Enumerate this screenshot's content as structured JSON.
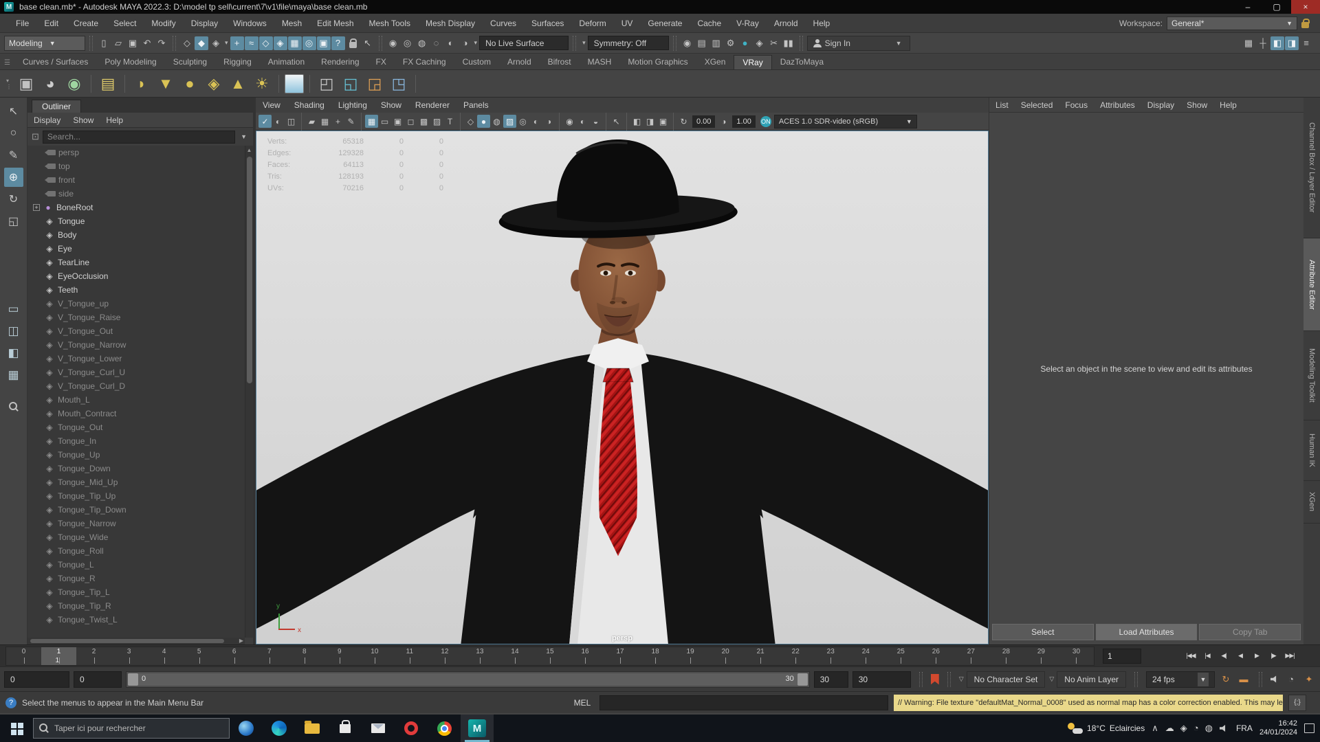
{
  "window": {
    "title": "base clean.mb* - Autodesk MAYA 2022.3: D:\\model tp sell\\current\\7\\v1\\file\\maya\\base clean.mb",
    "controls": [
      {
        "name": "minimize-button",
        "glyph": "–"
      },
      {
        "name": "maximize-button",
        "glyph": "▢"
      },
      {
        "name": "close-button",
        "glyph": "×"
      }
    ]
  },
  "menubar": {
    "items": [
      "File",
      "Edit",
      "Create",
      "Select",
      "Modify",
      "Display",
      "Windows",
      "Mesh",
      "Edit Mesh",
      "Mesh Tools",
      "Mesh Display",
      "Curves",
      "Surfaces",
      "Deform",
      "UV",
      "Generate",
      "Cache",
      "V-Ray",
      "Arnold",
      "Help"
    ],
    "workspace_label": "Workspace:",
    "workspace_value": "General*"
  },
  "statusline": {
    "mode": "Modeling",
    "no_live_surface": "No Live Surface",
    "symmetry": "Symmetry: Off",
    "signin": "Sign In",
    "file_icons": [
      {
        "name": "new-scene-icon",
        "glyph": "▯"
      },
      {
        "name": "open-scene-icon",
        "glyph": "▱"
      },
      {
        "name": "save-scene-icon",
        "glyph": "▣"
      },
      {
        "name": "undo-icon",
        "glyph": "↶"
      },
      {
        "name": "redo-icon",
        "glyph": "↷"
      }
    ],
    "selection_icons": [
      {
        "name": "select-hierarchy-icon",
        "glyph": "◇"
      },
      {
        "name": "select-object-icon",
        "glyph": "◆",
        "hl": true
      },
      {
        "name": "select-component-icon",
        "glyph": "◈"
      }
    ],
    "snap_icons": [
      {
        "name": "snap-grid-icon",
        "glyph": "+",
        "hl": true
      },
      {
        "name": "snap-curve-icon",
        "glyph": "≈",
        "hl": true
      },
      {
        "name": "snap-point-icon",
        "glyph": "◇",
        "hl": true
      },
      {
        "name": "snap-projected-center-icon",
        "glyph": "◈",
        "hl": true
      },
      {
        "name": "snap-view-plane-icon",
        "glyph": "▦",
        "hl": true
      },
      {
        "name": "make-live-icon",
        "glyph": "◎",
        "hl": true
      },
      {
        "name": "quick-rename-icon",
        "glyph": "▣",
        "hl": true
      },
      {
        "name": "snap-help-icon",
        "glyph": "?",
        "hl": true
      }
    ],
    "history_icons": [
      {
        "name": "input-connections-icon",
        "glyph": "◉"
      },
      {
        "name": "output-connections-icon",
        "glyph": "◎"
      },
      {
        "name": "construction-history-icon",
        "glyph": "◍"
      },
      {
        "name": "node-editor-icon",
        "glyph": "◌"
      },
      {
        "name": "hypergraph-icon",
        "glyph": "◐"
      },
      {
        "name": "connection-editor-icon",
        "glyph": "◑"
      }
    ],
    "render_icons": [
      {
        "name": "render-current-frame-icon",
        "glyph": "◉"
      },
      {
        "name": "render-region-icon",
        "glyph": "▤"
      },
      {
        "name": "ipr-render-icon",
        "glyph": "▥"
      },
      {
        "name": "render-settings-icon",
        "glyph": "⚙"
      },
      {
        "name": "color-management-icon",
        "glyph": "●",
        "color": "#3fb2c4"
      },
      {
        "name": "light-editor-icon",
        "glyph": "◈"
      },
      {
        "name": "render-setup-icon",
        "glyph": "✂"
      },
      {
        "name": "pause-viewport-icon",
        "glyph": "▮▮"
      }
    ],
    "right_icons": [
      {
        "name": "modeling-toolkit-toggle-icon",
        "glyph": "▦"
      },
      {
        "name": "humanik-toggle-icon",
        "glyph": "┼"
      },
      {
        "name": "channel-box-toggle-icon",
        "glyph": "◧",
        "hl": true
      },
      {
        "name": "attribute-editor-toggle-icon",
        "glyph": "◨",
        "hl": true
      },
      {
        "name": "display-layers-toggle-icon",
        "glyph": "≡"
      }
    ]
  },
  "shelf": {
    "tabs": [
      "Curves / Surfaces",
      "Poly Modeling",
      "Sculpting",
      "Rigging",
      "Animation",
      "Rendering",
      "FX",
      "FX Caching",
      "Custom",
      "Arnold",
      "Bifrost",
      "MASH",
      "Motion Graphics",
      "XGen",
      "VRay",
      "DazToMaya"
    ],
    "active_tab": "VRay",
    "icons": [
      {
        "name": "vray-render-settings-icon",
        "glyph": "▣",
        "color": "#c2c2c2"
      },
      {
        "name": "vray-frame-buffer-icon",
        "glyph": "◕",
        "color": "#cccccc"
      },
      {
        "name": "vray-render-icon",
        "glyph": "◉",
        "color": "#9fd6a0"
      },
      {
        "divider": true
      },
      {
        "name": "vray-light-lister-icon",
        "glyph": "▤",
        "color": "#ddc96a"
      },
      {
        "divider": true
      },
      {
        "name": "vray-dome-light-icon",
        "glyph": "◗",
        "color": "#d9c255"
      },
      {
        "name": "vray-rect-light-icon",
        "glyph": "▼",
        "color": "#d9c255"
      },
      {
        "name": "vray-sphere-light-icon",
        "glyph": "●",
        "color": "#d9c255"
      },
      {
        "name": "vray-geo-sphere-icon",
        "glyph": "◈",
        "color": "#d9c255"
      },
      {
        "name": "vray-ies-light-icon",
        "glyph": "▲",
        "color": "#d9c255"
      },
      {
        "name": "vray-sun-light-icon",
        "glyph": "☀",
        "color": "#d9c255"
      },
      {
        "divider": true
      },
      {
        "name": "vray-sky-icon",
        "cls": "sky"
      },
      {
        "divider": true
      },
      {
        "name": "vray-proxy-export-icon",
        "glyph": "◰",
        "color": "#c8c8c8"
      },
      {
        "name": "vray-proxy-import-icon",
        "glyph": "◱",
        "color": "#66c2d6"
      },
      {
        "name": "vray-scene-import-icon",
        "glyph": "◲",
        "color": "#e0a055"
      },
      {
        "name": "vray-volume-grid-icon",
        "glyph": "◳",
        "color": "#8ab8e0"
      },
      {
        "divider": true
      }
    ]
  },
  "toolbox": {
    "tools": [
      {
        "name": "select-tool-icon",
        "glyph": "↖"
      },
      {
        "name": "lasso-tool-icon",
        "glyph": "○"
      },
      {
        "name": "paint-select-tool-icon",
        "glyph": "✎"
      },
      {
        "name": "move-tool-icon",
        "glyph": "⊕",
        "hl": true
      },
      {
        "name": "rotate-tool-icon",
        "glyph": "↻"
      },
      {
        "name": "scale-tool-icon",
        "glyph": "◱"
      }
    ],
    "layouts": [
      {
        "name": "layout-single-pane-icon",
        "glyph": "▭"
      },
      {
        "name": "layout-two-pane-icon",
        "glyph": "◫"
      },
      {
        "name": "layout-pane-sidebar-icon",
        "glyph": "◧"
      },
      {
        "name": "layout-four-pane-icon",
        "glyph": "▦"
      }
    ]
  },
  "outliner": {
    "title": "Outliner",
    "menus": [
      "Display",
      "Show",
      "Help"
    ],
    "search_placeholder": "Search...",
    "items": [
      {
        "label": "persp",
        "type": "camera",
        "dim": true
      },
      {
        "label": "top",
        "type": "camera",
        "dim": true
      },
      {
        "label": "front",
        "type": "camera",
        "dim": true
      },
      {
        "label": "side",
        "type": "camera",
        "dim": true
      },
      {
        "label": "BoneRoot",
        "type": "joint",
        "exp": true
      },
      {
        "label": "Tongue",
        "type": "mesh"
      },
      {
        "label": "Body",
        "type": "mesh"
      },
      {
        "label": "Eye",
        "type": "mesh"
      },
      {
        "label": "TearLine",
        "type": "mesh"
      },
      {
        "label": "EyeOcclusion",
        "type": "mesh"
      },
      {
        "label": "Teeth",
        "type": "mesh"
      },
      {
        "label": "V_Tongue_up",
        "type": "mesh",
        "dim": true
      },
      {
        "label": "V_Tongue_Raise",
        "type": "mesh",
        "dim": true
      },
      {
        "label": "V_Tongue_Out",
        "type": "mesh",
        "dim": true
      },
      {
        "label": "V_Tongue_Narrow",
        "type": "mesh",
        "dim": true
      },
      {
        "label": "V_Tongue_Lower",
        "type": "mesh",
        "dim": true
      },
      {
        "label": "V_Tongue_Curl_U",
        "type": "mesh",
        "dim": true
      },
      {
        "label": "V_Tongue_Curl_D",
        "type": "mesh",
        "dim": true
      },
      {
        "label": "Mouth_L",
        "type": "mesh",
        "dim": true
      },
      {
        "label": "Mouth_Contract",
        "type": "mesh",
        "dim": true
      },
      {
        "label": "Tongue_Out",
        "type": "mesh",
        "dim": true
      },
      {
        "label": "Tongue_In",
        "type": "mesh",
        "dim": true
      },
      {
        "label": "Tongue_Up",
        "type": "mesh",
        "dim": true
      },
      {
        "label": "Tongue_Down",
        "type": "mesh",
        "dim": true
      },
      {
        "label": "Tongue_Mid_Up",
        "type": "mesh",
        "dim": true
      },
      {
        "label": "Tongue_Tip_Up",
        "type": "mesh",
        "dim": true
      },
      {
        "label": "Tongue_Tip_Down",
        "type": "mesh",
        "dim": true
      },
      {
        "label": "Tongue_Narrow",
        "type": "mesh",
        "dim": true
      },
      {
        "label": "Tongue_Wide",
        "type": "mesh",
        "dim": true
      },
      {
        "label": "Tongue_Roll",
        "type": "mesh",
        "dim": true
      },
      {
        "label": "Tongue_L",
        "type": "mesh",
        "dim": true
      },
      {
        "label": "Tongue_R",
        "type": "mesh",
        "dim": true
      },
      {
        "label": "Tongue_Tip_L",
        "type": "mesh",
        "dim": true
      },
      {
        "label": "Tongue_Tip_R",
        "type": "mesh",
        "dim": true
      },
      {
        "label": "Tongue_Twist_L",
        "type": "mesh",
        "dim": true
      }
    ]
  },
  "viewport": {
    "menus": [
      "View",
      "Shading",
      "Lighting",
      "Show",
      "Renderer",
      "Panels"
    ],
    "toolbar": {
      "groups": [
        [
          {
            "name": "select-camera-icon",
            "glyph": "✓",
            "hl": true
          },
          {
            "name": "lock-camera-icon",
            "glyph": "◐"
          },
          {
            "name": "camera-attributes-icon",
            "glyph": "◫"
          }
        ],
        [
          {
            "name": "bookmark-icon",
            "glyph": "▰"
          },
          {
            "name": "image-plane-icon",
            "glyph": "▦"
          },
          {
            "name": "2d-pan-zoom-icon",
            "glyph": "+"
          },
          {
            "name": "grease-pencil-icon",
            "glyph": "✎"
          }
        ],
        [
          {
            "name": "grid-icon",
            "glyph": "▦",
            "hl": true
          },
          {
            "name": "film-gate-icon",
            "glyph": "▭"
          },
          {
            "name": "resolution-gate-icon",
            "glyph": "▣"
          },
          {
            "name": "gate-mask-icon",
            "glyph": "◻"
          },
          {
            "name": "field-chart-icon",
            "glyph": "▩"
          },
          {
            "name": "safe-action-icon",
            "glyph": "▨"
          },
          {
            "name": "safe-title-icon",
            "glyph": "T"
          }
        ],
        [
          {
            "name": "wireframe-icon",
            "glyph": "◇"
          },
          {
            "name": "smooth-shade-icon",
            "glyph": "●",
            "hl": true
          },
          {
            "name": "wireframe-on-shaded-icon",
            "glyph": "◍"
          },
          {
            "name": "textured-icon",
            "glyph": "▨",
            "hl": true
          },
          {
            "name": "use-default-material-icon",
            "glyph": "◎"
          },
          {
            "name": "xray-icon",
            "glyph": "◐"
          },
          {
            "name": "backface-culling-icon",
            "glyph": "◑"
          }
        ],
        [
          {
            "name": "all-lights-icon",
            "glyph": "◉"
          },
          {
            "name": "shadows-icon",
            "glyph": "◐"
          },
          {
            "name": "screen-space-ao-icon",
            "glyph": "◒"
          }
        ],
        [
          {
            "name": "isolate-select-icon",
            "glyph": "↖"
          }
        ],
        [
          {
            "name": "viewport-layout-a-icon",
            "glyph": "◧"
          },
          {
            "name": "viewport-layout-b-icon",
            "glyph": "◨"
          },
          {
            "name": "viewport-n-icon",
            "glyph": "▣"
          }
        ]
      ],
      "exposure_icon": "↻",
      "exposure": "0.00",
      "gamma_icon": "◑",
      "gamma": "1.00",
      "colorspace": "ACES 1.0 SDR-video (sRGB)"
    },
    "hud": {
      "rows": [
        {
          "label": "Verts:",
          "a": "65318",
          "b": "0",
          "c": "0"
        },
        {
          "label": "Edges:",
          "a": "129328",
          "b": "0",
          "c": "0"
        },
        {
          "label": "Faces:",
          "a": "64113",
          "b": "0",
          "c": "0"
        },
        {
          "label": "Tris:",
          "a": "128193",
          "b": "0",
          "c": "0"
        },
        {
          "label": "UVs:",
          "a": "70216",
          "b": "0",
          "c": "0"
        }
      ]
    },
    "axis": {
      "x": "x",
      "y": "y"
    },
    "camera_label": "persp"
  },
  "attribute_editor": {
    "menus": [
      "List",
      "Selected",
      "Focus",
      "Attributes",
      "Display",
      "Show",
      "Help"
    ],
    "empty_message": "Select an object in the scene to view and edit its attributes",
    "buttons": [
      {
        "label": "Select",
        "name": "select-button"
      },
      {
        "label": "Load Attributes",
        "name": "load-attributes-button",
        "primary": true
      },
      {
        "label": "Copy Tab",
        "name": "copy-tab-button",
        "disabled": true
      }
    ]
  },
  "side_tabs": {
    "items": [
      "Channel Box / Layer Editor",
      "Attribute Editor",
      "Modeling Toolkit",
      "Human IK",
      "XGen"
    ],
    "active": "Attribute Editor"
  },
  "timeline": {
    "start": 0,
    "end": 30,
    "current": 1,
    "current_sub": "1",
    "current_field": "1",
    "playback": [
      {
        "name": "go-to-start-button",
        "glyph": "|◀◀"
      },
      {
        "name": "step-back-frame-button",
        "glyph": "|◀"
      },
      {
        "name": "step-back-key-button",
        "glyph": "◀|"
      },
      {
        "name": "play-backwards-button",
        "glyph": "◀"
      },
      {
        "name": "play-forwards-button",
        "glyph": "▶"
      },
      {
        "name": "step-forward-key-button",
        "glyph": "|▶"
      },
      {
        "name": "go-to-end-button",
        "glyph": "▶▶|"
      }
    ]
  },
  "range_slider": {
    "fields_left": [
      "0",
      "0"
    ],
    "range_start": "0",
    "range_end": "30",
    "fields_right": [
      "30",
      "30"
    ],
    "character_set": "No Character Set",
    "anim_layer": "No Anim Layer",
    "fps": "24 fps",
    "loop_icon": "↻",
    "clapper_icon": "▬",
    "clock_icon": "◔",
    "runner_icon": "✦"
  },
  "command_line": {
    "help_icon": "?",
    "help_text": "Select the menus to appear in the Main Menu Bar",
    "mel_label": "MEL",
    "warning": "// Warning: File texture \"defaultMat_Normal_0008\" used as normal map has a color correction enabled. This may le",
    "script_icon": "{;}"
  },
  "taskbar": {
    "search_placeholder": "Taper ici pour rechercher",
    "apps": [
      {
        "name": "cortana-ball-icon",
        "cls": "ic-ball"
      },
      {
        "name": "edge-icon",
        "cls": "ic-edge"
      },
      {
        "name": "file-explorer-icon",
        "cls": "ic-folder"
      },
      {
        "name": "store-icon",
        "cls": "ic-store"
      },
      {
        "name": "mail-icon",
        "cls": "ic-mail"
      },
      {
        "name": "opera-icon",
        "cls": "ic-opera"
      },
      {
        "name": "chrome-icon",
        "cls": "ic-chrome"
      },
      {
        "name": "maya-icon",
        "cls": "ic-maya",
        "active": true
      }
    ],
    "tray": {
      "weather_temp": "18°C",
      "weather_desc": "Eclaircies",
      "caret": "∧",
      "icons": [
        {
          "name": "cloud-tray-icon",
          "glyph": "☁"
        },
        {
          "name": "security-tray-icon",
          "glyph": "◈"
        },
        {
          "name": "clock-tray-icon",
          "glyph": "◔"
        },
        {
          "name": "network-tray-icon",
          "glyph": "◍"
        }
      ],
      "lang": "FRA",
      "time": "16:42",
      "date": "24/01/2024"
    }
  }
}
